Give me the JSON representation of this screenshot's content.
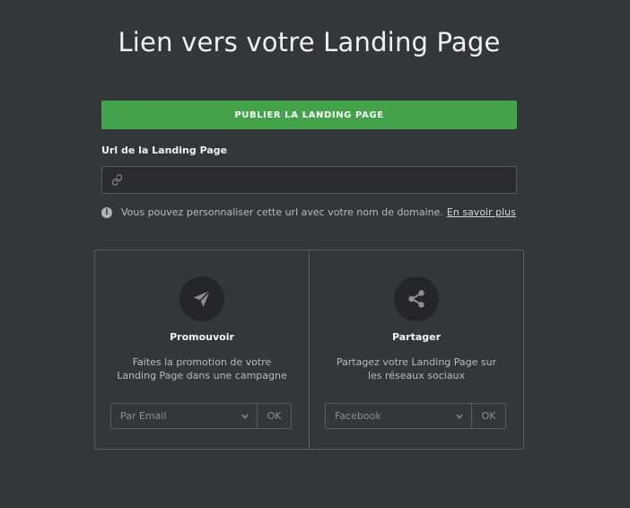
{
  "header": {
    "title": "Lien vers votre Landing Page"
  },
  "publish": {
    "label": "PUBLIER LA LANDING PAGE",
    "color": "#44a34a"
  },
  "url": {
    "label": "Url de la Landing Page",
    "value": "",
    "placeholder": "",
    "icon": "link-icon"
  },
  "info": {
    "text": "Vous pouvez personnaliser cette url avec votre nom de domaine.",
    "link": "En savoir plus",
    "icon": "info-icon"
  },
  "cards": [
    {
      "icon": "paper-plane-icon",
      "title": "Promouvoir",
      "desc_line1": "Faites la promotion de votre",
      "desc_line2": "Landing Page dans une campagne",
      "select_value": "Par Email",
      "ok_label": "OK"
    },
    {
      "icon": "share-icon",
      "title": "Partager",
      "desc_line1": "Partagez votre Landing Page sur",
      "desc_line2": "les réseaux sociaux",
      "select_value": "Facebook",
      "ok_label": "OK"
    }
  ]
}
